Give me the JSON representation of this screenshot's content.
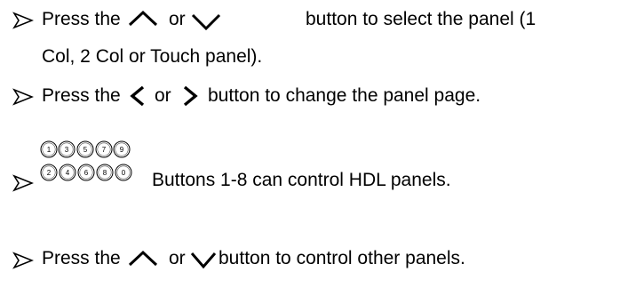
{
  "instructions": {
    "item1": {
      "prefix": "Press the",
      "or": "or",
      "suffix": "button to select the panel (1",
      "continuation": "Col, 2 Col or Touch panel)."
    },
    "item2": {
      "prefix": "Press the",
      "or": "or",
      "suffix": "button to change the panel page."
    },
    "item3": {
      "keypad_top": [
        "1",
        "3",
        "5",
        "7",
        "9"
      ],
      "keypad_bottom": [
        "2",
        "4",
        "6",
        "8",
        "0"
      ],
      "text": "Buttons 1-8 can control HDL panels."
    },
    "item4": {
      "prefix": "Press the",
      "or": "or",
      "suffix": "button to control other panels."
    }
  },
  "icons": {
    "bullet": "arrowhead-bullet-icon",
    "up": "chevron-up-icon",
    "down": "chevron-down-icon",
    "left": "chevron-left-icon",
    "right": "chevron-right-icon",
    "keypad": "numeric-keypad-icon"
  }
}
